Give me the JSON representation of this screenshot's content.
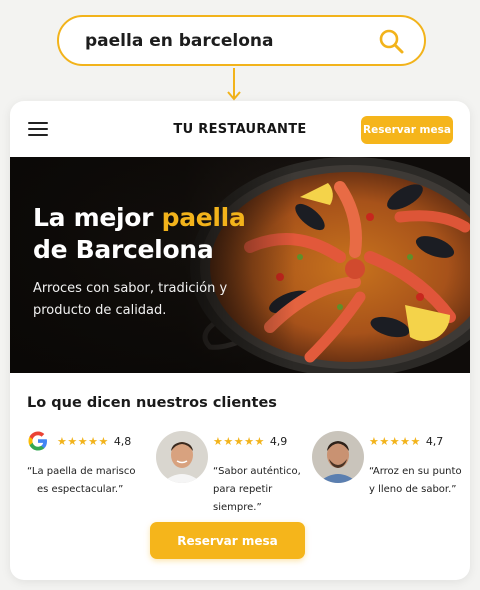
{
  "search": {
    "query": "paella en barcelona"
  },
  "header": {
    "brand": "TU RESTAURANTE",
    "reserve_label": "Reservar mesa"
  },
  "hero": {
    "title_part1": "La mejor ",
    "title_accent": "paella",
    "title_part2": "de Barcelona",
    "subtitle": "Arroces con sabor, tradición y producto de calidad."
  },
  "reviews": {
    "heading": "Lo que dicen nuestros clientes",
    "items": [
      {
        "source": "google-icon",
        "stars": "★★★★★",
        "rating": "4,8",
        "quote_line1": "“La paella de marisco",
        "quote_line2": "es espectacular.”"
      },
      {
        "source": "avatar",
        "stars": "★★★★★",
        "rating": "4,9",
        "quote_line1": "“Sabor auténtico,",
        "quote_line2": "para repetir siempre.”"
      },
      {
        "source": "avatar",
        "stars": "★★★★★",
        "rating": "4,7",
        "quote_line1": "“Arroz en su punto",
        "quote_line2": "y lleno de sabor.”"
      }
    ]
  },
  "cta": {
    "label": "Reservar mesa"
  },
  "colors": {
    "accent": "#f5b51b",
    "text": "#1a1a1a",
    "hero_bg": "#0f0c0a"
  }
}
